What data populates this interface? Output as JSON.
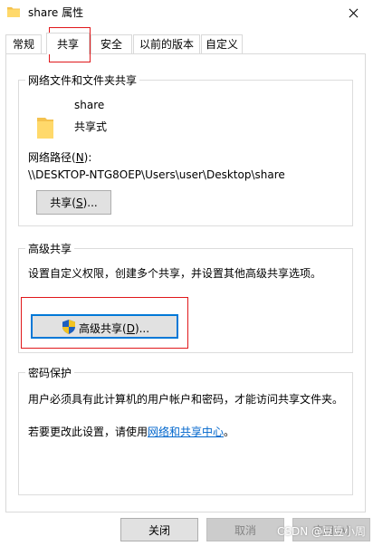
{
  "window": {
    "title": "share 属性"
  },
  "tabs": [
    {
      "label": "常规"
    },
    {
      "label": "共享"
    },
    {
      "label": "安全"
    },
    {
      "label": "以前的版本"
    },
    {
      "label": "自定义"
    }
  ],
  "network_share": {
    "group_title": "网络文件和文件夹共享",
    "folder_name": "share",
    "share_state": "共享式",
    "path_label_prefix": "网络路径(",
    "path_label_key": "N",
    "path_label_suffix": "):",
    "path_value": "\\\\DESKTOP-NTG8OEP\\Users\\user\\Desktop\\share",
    "share_button_prefix": "共享(",
    "share_button_key": "S",
    "share_button_suffix": ")..."
  },
  "advanced_share": {
    "group_title": "高级共享",
    "description": "设置自定义权限，创建多个共享，并设置其他高级共享选项。",
    "button_prefix": "高级共享(",
    "button_key": "D",
    "button_suffix": ")..."
  },
  "password": {
    "group_title": "密码保护",
    "description": "用户必须具有此计算机的用户帐户和密码，才能访问共享文件夹。",
    "change_prefix": "若要更改此设置，请使用",
    "link_text": "网络和共享中心",
    "change_suffix": "。"
  },
  "footer": {
    "close_label": "关闭",
    "cancel_label": "取消",
    "apply_label": "应用(A)"
  },
  "watermark": "CSDN @豆豆小周",
  "colors": {
    "highlight_box": "#e0181b",
    "link": "#0066cc",
    "focus": "#0078d7",
    "folder": "#f4c24e"
  }
}
